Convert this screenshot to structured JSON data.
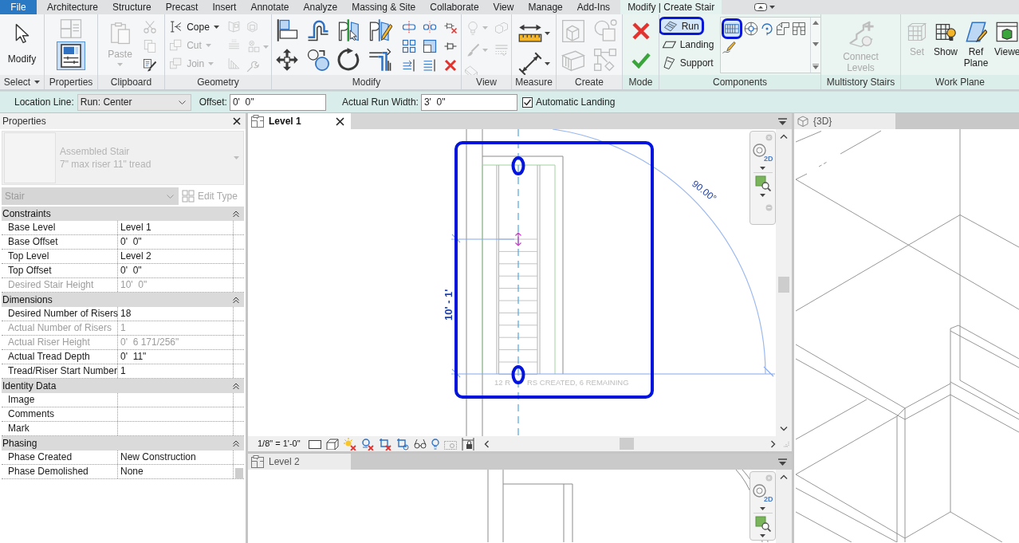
{
  "ribbon_tabs": [
    {
      "label": "File",
      "kind": "file",
      "selected": false
    },
    {
      "label": "Architecture",
      "kind": "tab",
      "selected": false
    },
    {
      "label": "Structure",
      "kind": "tab",
      "selected": false
    },
    {
      "label": "Precast",
      "kind": "tab",
      "selected": false
    },
    {
      "label": "Insert",
      "kind": "tab",
      "selected": false
    },
    {
      "label": "Annotate",
      "kind": "tab",
      "selected": false
    },
    {
      "label": "Analyze",
      "kind": "tab",
      "selected": false
    },
    {
      "label": "Massing & Site",
      "kind": "tab",
      "selected": false
    },
    {
      "label": "Collaborate",
      "kind": "tab",
      "selected": false
    },
    {
      "label": "View",
      "kind": "tab",
      "selected": false
    },
    {
      "label": "Manage",
      "kind": "tab",
      "selected": false
    },
    {
      "label": "Add-Ins",
      "kind": "tab",
      "selected": false
    },
    {
      "label": "Modify | Create Stair",
      "kind": "contextual",
      "selected": true
    }
  ],
  "ribbon_panels": [
    {
      "label": "Select",
      "dropdown": true,
      "tools": [
        {
          "label": "Modify",
          "kind": "large",
          "disabled": false,
          "selected": false,
          "dropdown": false
        }
      ]
    },
    {
      "label": "Properties",
      "dropdown": false,
      "tools": [
        {
          "kind": "icon",
          "disabled": true,
          "selected": false,
          "dropdown": false
        },
        {
          "kind": "icon",
          "disabled": false,
          "selected": true,
          "dropdown": false
        }
      ]
    },
    {
      "label": "Clipboard",
      "dropdown": false,
      "tools": [
        {
          "label": "Paste",
          "kind": "large",
          "disabled": true,
          "selected": false,
          "dropdown": true
        },
        {
          "kind": "icon",
          "disabled": true,
          "selected": false,
          "dropdown": false
        },
        {
          "kind": "icon",
          "disabled": true,
          "selected": false,
          "dropdown": false
        },
        {
          "kind": "icon",
          "disabled": false,
          "selected": false,
          "dropdown": false
        }
      ]
    },
    {
      "label": "Geometry",
      "dropdown": false,
      "tools": [
        {
          "label": "Cope",
          "kind": "small",
          "disabled": false,
          "selected": false,
          "dropdown": true
        },
        {
          "label": "Cut",
          "kind": "small",
          "disabled": true,
          "selected": false,
          "dropdown": true
        },
        {
          "label": "Join",
          "kind": "small",
          "disabled": true,
          "selected": false,
          "dropdown": true
        },
        {
          "kind": "icon",
          "disabled": true,
          "selected": false,
          "dropdown": false
        },
        {
          "kind": "icon",
          "disabled": true,
          "selected": false,
          "dropdown": false
        },
        {
          "kind": "icon",
          "disabled": true,
          "selected": false,
          "dropdown": false
        },
        {
          "kind": "icon",
          "disabled": true,
          "selected": false,
          "dropdown": false
        },
        {
          "kind": "icon",
          "disabled": true,
          "selected": false,
          "dropdown": true
        },
        {
          "kind": "icon",
          "disabled": true,
          "selected": false,
          "dropdown": false
        }
      ]
    },
    {
      "label": "Modify",
      "dropdown": false,
      "tools": [
        {
          "kind": "icon",
          "disabled": false,
          "selected": false,
          "dropdown": false
        },
        {
          "kind": "icon",
          "disabled": false,
          "selected": false,
          "dropdown": false
        },
        {
          "kind": "icon",
          "disabled": false,
          "selected": false,
          "dropdown": false
        },
        {
          "kind": "icon",
          "disabled": false,
          "selected": false,
          "dropdown": false
        },
        {
          "kind": "icon",
          "disabled": false,
          "selected": false,
          "dropdown": false
        },
        {
          "kind": "icon",
          "disabled": false,
          "selected": false,
          "dropdown": false
        },
        {
          "kind": "icon",
          "disabled": false,
          "selected": false,
          "dropdown": false
        },
        {
          "kind": "icon",
          "disabled": false,
          "selected": false,
          "dropdown": false
        },
        {
          "kind": "icon",
          "disabled": false,
          "selected": false,
          "dropdown": false
        },
        {
          "kind": "icon",
          "disabled": false,
          "selected": false,
          "dropdown": false
        },
        {
          "kind": "icon",
          "disabled": false,
          "selected": false,
          "dropdown": false
        },
        {
          "kind": "icon",
          "disabled": false,
          "selected": false,
          "dropdown": false
        },
        {
          "kind": "icon",
          "disabled": false,
          "selected": false,
          "dropdown": false
        },
        {
          "kind": "icon",
          "disabled": false,
          "selected": false,
          "dropdown": false
        },
        {
          "kind": "icon",
          "disabled": false,
          "selected": false,
          "dropdown": false
        },
        {
          "kind": "icon",
          "disabled": false,
          "selected": false,
          "dropdown": false
        },
        {
          "kind": "icon",
          "disabled": false,
          "selected": false,
          "dropdown": false
        }
      ]
    },
    {
      "label": "View",
      "dropdown": false,
      "tools": [
        {
          "kind": "icon",
          "disabled": true,
          "selected": false,
          "dropdown": true
        },
        {
          "kind": "icon",
          "disabled": true,
          "selected": false,
          "dropdown": false
        },
        {
          "kind": "icon",
          "disabled": true,
          "selected": false,
          "dropdown": true
        },
        {
          "kind": "icon",
          "disabled": true,
          "selected": false,
          "dropdown": false
        },
        {
          "kind": "icon",
          "disabled": true,
          "selected": false,
          "dropdown": false
        }
      ]
    },
    {
      "label": "Measure",
      "dropdown": false,
      "tools": [
        {
          "kind": "icon",
          "disabled": false,
          "selected": false,
          "dropdown": true
        },
        {
          "kind": "icon",
          "disabled": false,
          "selected": false,
          "dropdown": true
        }
      ]
    },
    {
      "label": "Create",
      "dropdown": false,
      "tools": [
        {
          "kind": "icon",
          "disabled": true,
          "selected": false,
          "dropdown": false
        },
        {
          "kind": "icon",
          "disabled": true,
          "selected": false,
          "dropdown": false
        },
        {
          "kind": "icon",
          "disabled": true,
          "selected": false,
          "dropdown": false
        },
        {
          "kind": "icon",
          "disabled": true,
          "selected": false,
          "dropdown": false
        }
      ]
    },
    {
      "label": "Mode",
      "dropdown": false,
      "tools": [
        {
          "kind": "icon",
          "disabled": false,
          "selected": false,
          "dropdown": false
        },
        {
          "kind": "icon",
          "disabled": false,
          "selected": false,
          "dropdown": false
        }
      ]
    },
    {
      "label": "Components",
      "dropdown": false,
      "tools": [
        {
          "label": "Run",
          "kind": "small",
          "disabled": false,
          "selected": true,
          "dropdown": false
        },
        {
          "label": "Landing",
          "kind": "small",
          "disabled": false,
          "selected": false,
          "dropdown": false
        },
        {
          "label": "Support",
          "kind": "small",
          "disabled": false,
          "selected": false,
          "dropdown": false
        },
        {
          "kind": "icon",
          "disabled": false,
          "selected": true,
          "dropdown": false
        },
        {
          "kind": "icon",
          "disabled": false,
          "selected": false,
          "dropdown": false
        },
        {
          "kind": "icon",
          "disabled": false,
          "selected": false,
          "dropdown": false
        },
        {
          "kind": "icon",
          "disabled": false,
          "selected": false,
          "dropdown": false
        },
        {
          "kind": "icon",
          "disabled": false,
          "selected": false,
          "dropdown": false
        },
        {
          "kind": "icon",
          "disabled": false,
          "selected": false,
          "dropdown": false
        }
      ]
    },
    {
      "label": "Multistory Stairs",
      "dropdown": false,
      "tools": [
        {
          "label": "Connect Levels",
          "kind": "large",
          "disabled": true,
          "selected": false,
          "dropdown": false
        }
      ]
    },
    {
      "label": "Work Plane",
      "dropdown": false,
      "tools": [
        {
          "label": "Set",
          "kind": "large",
          "disabled": true,
          "selected": false,
          "dropdown": false
        },
        {
          "label": "Show",
          "kind": "large",
          "disabled": false,
          "selected": false,
          "dropdown": false
        },
        {
          "label": "Ref Plane",
          "kind": "large",
          "disabled": false,
          "selected": false,
          "dropdown": false
        },
        {
          "label": "Viewe",
          "kind": "large",
          "disabled": false,
          "selected": false,
          "dropdown": false
        }
      ]
    }
  ],
  "options_bar": {
    "location_line": {
      "label": "Location Line:",
      "value": "Run: Center"
    },
    "offset": {
      "label": "Offset:",
      "value": "0'  0\""
    },
    "actual_run_width": {
      "label": "Actual Run Width:",
      "value": "3'  0\""
    },
    "automatic_landing": {
      "label": "Automatic Landing",
      "checked": true
    }
  },
  "properties_palette": {
    "title": "Properties",
    "type_selector": {
      "family": "Assembled Stair",
      "type": "7\" max riser 11\" tread",
      "disabled": true
    },
    "category_filter": {
      "value": "Stair",
      "disabled": true
    },
    "edit_type": {
      "label": "Edit Type",
      "disabled": true
    },
    "groups": [
      {
        "name": "Constraints",
        "expanded": true,
        "rows": [
          {
            "name": "Base Level",
            "value": "Level 1",
            "disabled": false
          },
          {
            "name": "Base Offset",
            "value": "0'  0\"",
            "disabled": false
          },
          {
            "name": "Top Level",
            "value": "Level 2",
            "disabled": false
          },
          {
            "name": "Top Offset",
            "value": "0'  0\"",
            "disabled": false
          },
          {
            "name": "Desired Stair Height",
            "value": "10'  0\"",
            "disabled": true
          }
        ]
      },
      {
        "name": "Dimensions",
        "expanded": true,
        "rows": [
          {
            "name": "Desired Number of Risers",
            "value": "18",
            "disabled": false
          },
          {
            "name": "Actual Number of Risers",
            "value": "1",
            "disabled": true
          },
          {
            "name": "Actual Riser Height",
            "value": "0'  6 171/256\"",
            "disabled": true
          },
          {
            "name": "Actual Tread Depth",
            "value": "0'  11\"",
            "disabled": false
          },
          {
            "name": "Tread/Riser Start Number",
            "value": "1",
            "disabled": false
          }
        ]
      },
      {
        "name": "Identity Data",
        "expanded": true,
        "rows": [
          {
            "name": "Image",
            "disabled": false
          },
          {
            "name": "Comments",
            "disabled": false
          },
          {
            "name": "Mark",
            "disabled": false
          }
        ]
      },
      {
        "name": "Phasing",
        "expanded": true,
        "rows": [
          {
            "name": "Phase Created",
            "value": "New Construction",
            "disabled": false
          },
          {
            "name": "Phase Demolished",
            "value": "None",
            "disabled": false
          }
        ]
      }
    ]
  },
  "level_1_view": {
    "tab": {
      "title": "Level 1",
      "selected": true
    },
    "navigation_bar": {
      "wheel_label": "2D"
    },
    "sketch": {
      "angle_label": "90.00°",
      "length_label": "10' - 1'",
      "riser_message_parts": [
        "12 R",
        "RS CREATED, 6 REMAINING"
      ]
    },
    "scale": "1/8\" = 1'-0\""
  },
  "level_2_view": {
    "tab": {
      "title": "Level 2",
      "selected": false
    },
    "navigation_bar": {
      "wheel_label": "2D"
    }
  },
  "view_3d": {
    "tab": {
      "title": "{3D}",
      "selected": false
    }
  }
}
